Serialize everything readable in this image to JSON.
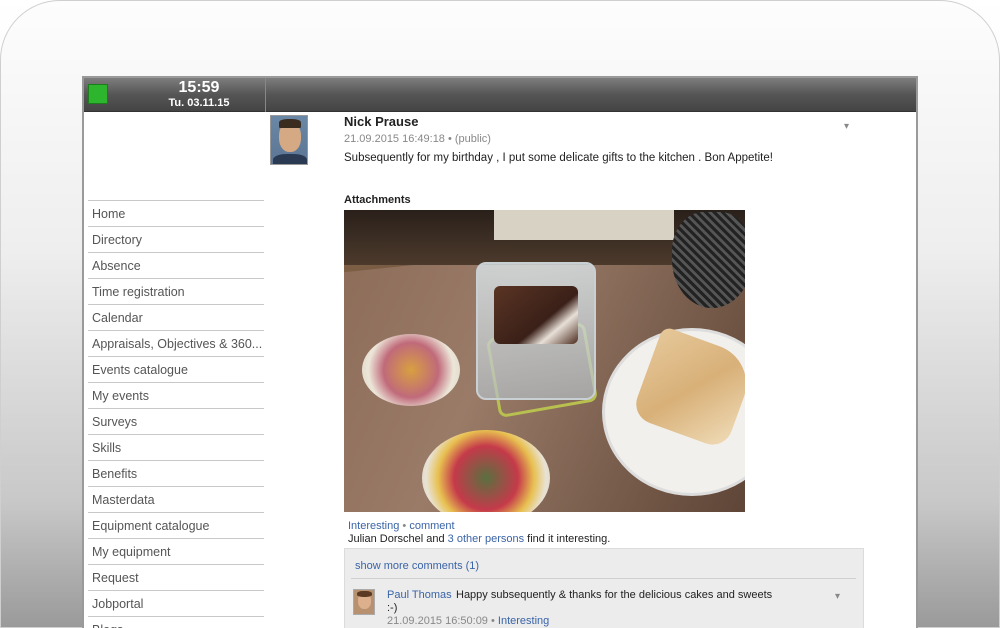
{
  "topbar": {
    "time": "15:59",
    "date": "Tu. 03.11.15",
    "status_color": "#2db52d"
  },
  "sidebar": {
    "items": [
      {
        "label": "Home"
      },
      {
        "label": "Directory"
      },
      {
        "label": "Absence"
      },
      {
        "label": "Time registration"
      },
      {
        "label": "Calendar"
      },
      {
        "label": "Appraisals, Objectives & 360..."
      },
      {
        "label": "Events catalogue"
      },
      {
        "label": "My events"
      },
      {
        "label": "Surveys"
      },
      {
        "label": "Skills"
      },
      {
        "label": "Benefits"
      },
      {
        "label": "Masterdata"
      },
      {
        "label": "Equipment catalogue"
      },
      {
        "label": "My equipment"
      },
      {
        "label": "Request"
      },
      {
        "label": "Jobportal"
      },
      {
        "label": "Blogs"
      }
    ]
  },
  "post": {
    "author": "Nick Prause",
    "meta": "21.09.2015 16:49:18 • (public)",
    "text": "Subsequently for my birthday , I put some delicate gifts to the kitchen . Bon Appetite!",
    "menu_icon": "▾",
    "attachments_label": "Attachments"
  },
  "reactions": {
    "interesting": "Interesting",
    "separator": " • ",
    "comment": "comment",
    "line2_prefix": "Julian Dorschel and ",
    "others_link": "3 other persons",
    "line2_suffix": " find it interesting."
  },
  "comments": {
    "show_more": "show more comments (1)",
    "items": [
      {
        "author": "Paul Thomas",
        "text": "Happy subsequently & thanks for the delicious cakes and sweets",
        "text_cont": ":-)",
        "timestamp": "21.09.2015 16:50:09",
        "separator": " • ",
        "action": "Interesting",
        "menu_icon": "▾"
      }
    ]
  }
}
